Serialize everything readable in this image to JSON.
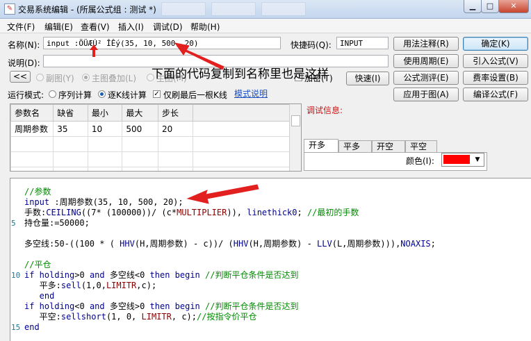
{
  "window": {
    "title": "交易系统编辑 - (所属公式组 : 测试 *)",
    "icon_glyph": "✎"
  },
  "menu": [
    "文件(F)",
    "编辑(E)",
    "查看(V)",
    "插入(I)",
    "调试(D)",
    "帮助(H)"
  ],
  "form": {
    "name_label": "名称(N):",
    "name_value": "input :ÖÜÆÚ² ÎÊý(35, 10, 500, 20)",
    "shortcut_label": "快捷码(Q):",
    "shortcut_value": "INPUT",
    "desc_label": "说明(D):",
    "desc_value": "",
    "collapse_btn": "<<",
    "radio_sub": "副图(Y)",
    "radio_overlay": "主图叠加(L)",
    "radio_main": "主图(M)",
    "encrypt_label": "加密(T)",
    "fast_btn": "快速(I)",
    "run_mode_label": "运行模式:",
    "run_seq": "序列计算",
    "run_tick": "逐K线计算",
    "refresh_last": "仅刷最后一根K线",
    "mode_help": "模式说明",
    "debug_info_label": "调试信息:"
  },
  "buttons": {
    "usage_note": "用法注释(R)",
    "confirm": "确定(K)",
    "use_period": "使用周期(E)",
    "import_formula": "引入公式(V)",
    "formula_test": "公式测评(E)",
    "cost_settings": "费率设置(B)",
    "apply_chart": "应用于图(A)",
    "compile_formula": "编译公式(F)"
  },
  "params_table": {
    "headers": [
      "参数名",
      "缺省",
      "最小",
      "最大",
      "步长"
    ],
    "rows": [
      [
        "周期参数",
        "35",
        "10",
        "500",
        "20"
      ]
    ]
  },
  "tabs": [
    "开多",
    "平多",
    "开空",
    "平空"
  ],
  "color_label": "颜色(I):",
  "color_value": "#ff0000",
  "annotation": "下面的代码复制到名称里也是这样",
  "code": {
    "line1": "//参数",
    "line2_kw": "input",
    "line2_rest": " :周期参数(35, 10, 500, 20);",
    "line3_a": "手数:",
    "line3_fn": "CEILING",
    "line3_b": "((7* (100000))/ (c*",
    "line3_cn": "MULTIPLIER",
    "line3_c": ")), ",
    "line3_kw": "linethick0",
    "line3_d": "; ",
    "line3_cm": "//最初的手数",
    "line4": "持仓量:=50000;",
    "line6_a": "多空线:50-((100 * ( ",
    "line6_fn1": "HHV",
    "line6_b": "(H,周期参数) - c))/ (",
    "line6_fn2": "HHV",
    "line6_c": "(H,周期参数) - ",
    "line6_fn3": "LLV",
    "line6_d": "(L,周期参数))),",
    "line6_kw": "NOAXIS",
    "line6_e": ";",
    "line8": "//平仓",
    "line9_if": "if",
    "line9_h": " holding",
    "line9_a": ">0 ",
    "line9_and": "and",
    "line9_b": " 多空线<0 ",
    "line9_then": "then begin",
    "line9_cm": " //判断平仓条件是否达到",
    "line10_a": "   平多:",
    "line10_fn": "sell",
    "line10_b": "(1,0,",
    "line10_cn": "LIMITR",
    "line10_c": ",c);",
    "line11": "   end",
    "line12_if": "if",
    "line12_h": " holding",
    "line12_a": "<0 ",
    "line12_and": "and",
    "line12_b": " 多空线>0 ",
    "line12_then": "then begin",
    "line12_cm": " //判断平仓条件是否达到",
    "line13_a": "   平空:",
    "line13_fn": "sellshort",
    "line13_b": "(1, 0, ",
    "line13_cn": "LIMITR",
    "line13_c": ", c);",
    "line13_cm": "//按指令价平仓",
    "line14": "end",
    "linenums": [
      "5",
      "10",
      "15"
    ]
  }
}
